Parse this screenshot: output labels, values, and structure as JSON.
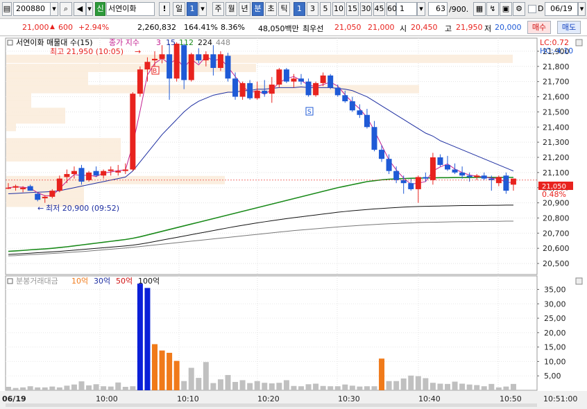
{
  "toolbar": {
    "code": "200880",
    "type_badge": "신",
    "stock_name": "서연이화",
    "excl": "!",
    "day": "일",
    "num_day": "1",
    "periods": [
      "주",
      "월",
      "년",
      "분",
      "초",
      "틱"
    ],
    "selected_period": "분",
    "intervals": [
      "1",
      "3",
      "5",
      "10",
      "15",
      "30",
      "45",
      "60"
    ],
    "selected_interval": "1",
    "count_value": "1",
    "zoom_value": "63",
    "zoom_total": "/900.",
    "d_label": "D",
    "date_value": "06/19"
  },
  "info": {
    "price": "21,000",
    "arrow": "▲",
    "change": "600",
    "change_pct": "+2.94%",
    "volume": "2,260,832",
    "vol_ratio": "164.41%",
    "turnover": "8.36%",
    "amount": "48,050백만",
    "best_bid_label": "최우선",
    "best_bid1": "21,050",
    "best_bid2": "21,000",
    "open_label": "시",
    "open": "20,450",
    "high_label": "고",
    "high": "21,950",
    "low_label": "저",
    "low": "20,000",
    "buy_label": "매수",
    "sell_label": "매도"
  },
  "colors": {
    "up": "#e8231e",
    "down": "#1f5ad6",
    "ma5": "#c21d8f",
    "ma15": "#1d2ea1",
    "ma112": "#1a8a1a",
    "ma224": "#111111",
    "ma448": "#777777",
    "orange": "#f07a1a",
    "vgray": "#c0c0c0"
  },
  "chart_data": {
    "type": "candlestick",
    "legend": {
      "name": "서연이화 매물대 수(15)",
      "ma_label": "종가 지수",
      "ma_periods": [
        "3",
        "15",
        "112",
        "224",
        "448"
      ]
    },
    "lc_label": "LC:0.72",
    "hc_label": "HC:-4.10",
    "price_ticks": [
      "21,900",
      "21,800",
      "21,700",
      "21,600",
      "21,500",
      "21,400",
      "21,300",
      "21,200",
      "21,100",
      "21,000",
      "20,900",
      "20,800",
      "20,700",
      "20,600",
      "20,500"
    ],
    "current_price": "21,050",
    "price_pct": "0.48%",
    "high_annot": "최고 21,950 (10:05)",
    "low_annot": "최저 20,900 (09:52)",
    "time_labels": [
      "06/19",
      "10:00",
      "10:10",
      "10:20",
      "10:30",
      "10:40",
      "10:50",
      "10:51:00"
    ],
    "volume_title": "분봉거래대금",
    "volume_legend": [
      "10억",
      "30억",
      "50억",
      "100억"
    ],
    "volume_ticks": [
      "35,00",
      "30,00",
      "25,00",
      "20,00",
      "15,00",
      "10,00",
      "5,00"
    ],
    "candles": [
      {
        "o": 21000,
        "h": 21030,
        "l": 20990,
        "c": 21000
      },
      {
        "o": 21000,
        "h": 21020,
        "l": 20980,
        "c": 21010
      },
      {
        "o": 20990,
        "h": 21010,
        "l": 20970,
        "c": 21000
      },
      {
        "o": 21010,
        "h": 21020,
        "l": 20980,
        "c": 20980
      },
      {
        "o": 20960,
        "h": 20970,
        "l": 20910,
        "c": 20920
      },
      {
        "o": 20930,
        "h": 20950,
        "l": 20900,
        "c": 20940
      },
      {
        "o": 20940,
        "h": 20990,
        "l": 20930,
        "c": 20980
      },
      {
        "o": 20980,
        "h": 21080,
        "l": 20970,
        "c": 21060
      },
      {
        "o": 21070,
        "h": 21120,
        "l": 21030,
        "c": 21090
      },
      {
        "o": 21090,
        "h": 21140,
        "l": 21060,
        "c": 21110
      },
      {
        "o": 21130,
        "h": 21150,
        "l": 21020,
        "c": 21040
      },
      {
        "o": 21050,
        "h": 21110,
        "l": 21040,
        "c": 21100
      },
      {
        "o": 21110,
        "h": 21140,
        "l": 21070,
        "c": 21080
      },
      {
        "o": 21080,
        "h": 21120,
        "l": 21060,
        "c": 21110
      },
      {
        "o": 21110,
        "h": 21140,
        "l": 21080,
        "c": 21120
      },
      {
        "o": 21100,
        "h": 21150,
        "l": 21080,
        "c": 21110
      },
      {
        "o": 21110,
        "h": 21160,
        "l": 21090,
        "c": 21120
      },
      {
        "o": 21120,
        "h": 21630,
        "l": 21110,
        "c": 21620
      },
      {
        "o": 21620,
        "h": 21800,
        "l": 21600,
        "c": 21780
      },
      {
        "o": 21780,
        "h": 21860,
        "l": 21700,
        "c": 21830
      },
      {
        "o": 21840,
        "h": 21900,
        "l": 21750,
        "c": 21850
      },
      {
        "o": 21850,
        "h": 21940,
        "l": 21820,
        "c": 21880
      },
      {
        "o": 21880,
        "h": 21950,
        "l": 21580,
        "c": 21720
      },
      {
        "o": 21720,
        "h": 21960,
        "l": 21700,
        "c": 21950
      },
      {
        "o": 21940,
        "h": 21950,
        "l": 21650,
        "c": 21710
      },
      {
        "o": 21710,
        "h": 21890,
        "l": 21700,
        "c": 21880
      },
      {
        "o": 21880,
        "h": 21920,
        "l": 21820,
        "c": 21840
      },
      {
        "o": 21840,
        "h": 21900,
        "l": 21800,
        "c": 21880
      },
      {
        "o": 21880,
        "h": 21940,
        "l": 21740,
        "c": 21790
      },
      {
        "o": 21790,
        "h": 21900,
        "l": 21770,
        "c": 21880
      },
      {
        "o": 21870,
        "h": 21890,
        "l": 21700,
        "c": 21720
      },
      {
        "o": 21720,
        "h": 21760,
        "l": 21580,
        "c": 21600
      },
      {
        "o": 21600,
        "h": 21700,
        "l": 21580,
        "c": 21690
      },
      {
        "o": 21690,
        "h": 21710,
        "l": 21580,
        "c": 21590
      },
      {
        "o": 21590,
        "h": 21700,
        "l": 21580,
        "c": 21640
      },
      {
        "o": 21640,
        "h": 21710,
        "l": 21600,
        "c": 21620
      },
      {
        "o": 21620,
        "h": 21730,
        "l": 21560,
        "c": 21680
      },
      {
        "o": 21680,
        "h": 21790,
        "l": 21660,
        "c": 21780
      },
      {
        "o": 21780,
        "h": 21790,
        "l": 21690,
        "c": 21700
      },
      {
        "o": 21700,
        "h": 21750,
        "l": 21660,
        "c": 21720
      },
      {
        "o": 21720,
        "h": 21750,
        "l": 21680,
        "c": 21700
      },
      {
        "o": 21700,
        "h": 21720,
        "l": 21600,
        "c": 21610
      },
      {
        "o": 21610,
        "h": 21700,
        "l": 21600,
        "c": 21690
      },
      {
        "o": 21690,
        "h": 21760,
        "l": 21670,
        "c": 21740
      },
      {
        "o": 21740,
        "h": 21750,
        "l": 21650,
        "c": 21660
      },
      {
        "o": 21660,
        "h": 21680,
        "l": 21600,
        "c": 21610
      },
      {
        "o": 21610,
        "h": 21640,
        "l": 21560,
        "c": 21570
      },
      {
        "o": 21570,
        "h": 21600,
        "l": 21500,
        "c": 21510
      },
      {
        "o": 21510,
        "h": 21550,
        "l": 21460,
        "c": 21480
      },
      {
        "o": 21480,
        "h": 21520,
        "l": 21390,
        "c": 21400
      },
      {
        "o": 21400,
        "h": 21440,
        "l": 21240,
        "c": 21250
      },
      {
        "o": 21250,
        "h": 21280,
        "l": 21170,
        "c": 21190
      },
      {
        "o": 21190,
        "h": 21220,
        "l": 21090,
        "c": 21110
      },
      {
        "o": 21110,
        "h": 21140,
        "l": 21030,
        "c": 21050
      },
      {
        "o": 21050,
        "h": 21080,
        "l": 20960,
        "c": 21030
      },
      {
        "o": 21030,
        "h": 21060,
        "l": 20980,
        "c": 20990
      },
      {
        "o": 20990,
        "h": 21080,
        "l": 20900,
        "c": 21070
      },
      {
        "o": 21070,
        "h": 21100,
        "l": 21040,
        "c": 21060
      },
      {
        "o": 21050,
        "h": 21230,
        "l": 21020,
        "c": 21200
      },
      {
        "o": 21200,
        "h": 21220,
        "l": 21140,
        "c": 21150
      },
      {
        "o": 21150,
        "h": 21210,
        "l": 21110,
        "c": 21120
      },
      {
        "o": 21120,
        "h": 21160,
        "l": 21090,
        "c": 21100
      },
      {
        "o": 21100,
        "h": 21140,
        "l": 21060,
        "c": 21080
      },
      {
        "o": 21080,
        "h": 21100,
        "l": 21040,
        "c": 21070
      },
      {
        "o": 21070,
        "h": 21090,
        "l": 21050,
        "c": 21080
      },
      {
        "o": 21080,
        "h": 21100,
        "l": 21050,
        "c": 21060
      },
      {
        "o": 21060,
        "h": 21080,
        "l": 20980,
        "c": 21050
      },
      {
        "o": 21030,
        "h": 21080,
        "l": 21010,
        "c": 21070
      },
      {
        "o": 21080,
        "h": 21100,
        "l": 20960,
        "c": 20980
      },
      {
        "o": 21020,
        "h": 21060,
        "l": 20980,
        "c": 21060
      }
    ],
    "ma15": [
      20960,
      20962,
      20965,
      20968,
      20970,
      20972,
      20975,
      20980,
      20990,
      21000,
      21010,
      21020,
      21030,
      21040,
      21050,
      21060,
      21070,
      21110,
      21170,
      21230,
      21290,
      21350,
      21400,
      21450,
      21500,
      21540,
      21570,
      21590,
      21610,
      21620,
      21630,
      21630,
      21640,
      21640,
      21650,
      21650,
      21655,
      21660,
      21660,
      21660,
      21665,
      21660,
      21660,
      21660,
      21660,
      21655,
      21650,
      21640,
      21620,
      21600,
      21570,
      21540,
      21510,
      21480,
      21450,
      21420,
      21390,
      21360,
      21340,
      21310,
      21290,
      21270,
      21250,
      21230,
      21210,
      21190,
      21170,
      21150,
      21130,
      21110
    ],
    "ma112": [
      20580,
      20583,
      20586,
      20590,
      20593,
      20596,
      20600,
      20605,
      20610,
      20616,
      20622,
      20628,
      20634,
      20640,
      20646,
      20652,
      20658,
      20666,
      20676,
      20688,
      20700,
      20712,
      20724,
      20736,
      20748,
      20760,
      20772,
      20784,
      20796,
      20808,
      20820,
      20832,
      20844,
      20856,
      20868,
      20880,
      20892,
      20904,
      20916,
      20928,
      20940,
      20952,
      20964,
      20976,
      20988,
      21000,
      21010,
      21020,
      21030,
      21040,
      21046,
      21052,
      21056,
      21058,
      21060,
      21062,
      21063,
      21064,
      21065,
      21066,
      21066,
      21067,
      21067,
      21067,
      21068,
      21068,
      21068,
      21068,
      21068,
      21068
    ],
    "ma224": [
      20560,
      20562,
      20565,
      20568,
      20571,
      20574,
      20577,
      20580,
      20584,
      20588,
      20592,
      20596,
      20600,
      20604,
      20608,
      20612,
      20616,
      20621,
      20628,
      20636,
      20645,
      20654,
      20663,
      20672,
      20681,
      20690,
      20699,
      20708,
      20717,
      20726,
      20735,
      20744,
      20752,
      20760,
      20768,
      20775,
      20782,
      20789,
      20796,
      20802,
      20808,
      20814,
      20820,
      20826,
      20832,
      20838,
      20843,
      20848,
      20852,
      20856,
      20860,
      20863,
      20866,
      20869,
      20872,
      20874,
      20876,
      20877,
      20878,
      20879,
      20880,
      20881,
      20882,
      20882,
      20883,
      20883,
      20884,
      20884,
      20885,
      20885
    ],
    "ma448": [
      20550,
      20552,
      20555,
      20558,
      20560,
      20563,
      20566,
      20569,
      20572,
      20575,
      20578,
      20582,
      20586,
      20590,
      20594,
      20598,
      20602,
      20607,
      20612,
      20617,
      20622,
      20627,
      20632,
      20637,
      20642,
      20647,
      20652,
      20657,
      20662,
      20667,
      20672,
      20677,
      20682,
      20687,
      20692,
      20697,
      20702,
      20707,
      20712,
      20717,
      20721,
      20725,
      20729,
      20733,
      20737,
      20741,
      20745,
      20748,
      20751,
      20754,
      20757,
      20760,
      20762,
      20764,
      20766,
      20768,
      20770,
      20771,
      20772,
      20773,
      20774,
      20775,
      20776,
      20776,
      20777,
      20777,
      20778,
      20778,
      20779,
      20779
    ],
    "volume": [
      1.2,
      0.8,
      1.0,
      1.4,
      1.0,
      1.0,
      1.3,
      1.0,
      1.6,
      2.0,
      3.1,
      1.7,
      2.1,
      1.4,
      1.3,
      2.7,
      1.2,
      1.4,
      37.0,
      35.5,
      16.0,
      13.8,
      13.0,
      10.2,
      3.2,
      7.8,
      4.3,
      9.8,
      2.5,
      3.8,
      5.3,
      2.9,
      3.5,
      2.5,
      3.2,
      2.6,
      2.4,
      2.6,
      3.5,
      1.5,
      1.4,
      2.1,
      2.3,
      1.5,
      1.4,
      1.4,
      2.0,
      1.6,
      1.3,
      1.4,
      1.4,
      11.0,
      3.2,
      3.2,
      4.1,
      5.1,
      4.9,
      4.2,
      2.6,
      2.3,
      2.2,
      3.0,
      2.3,
      2.0,
      1.8,
      1.4,
      2.2,
      1.0,
      1.3,
      2.2
    ]
  }
}
